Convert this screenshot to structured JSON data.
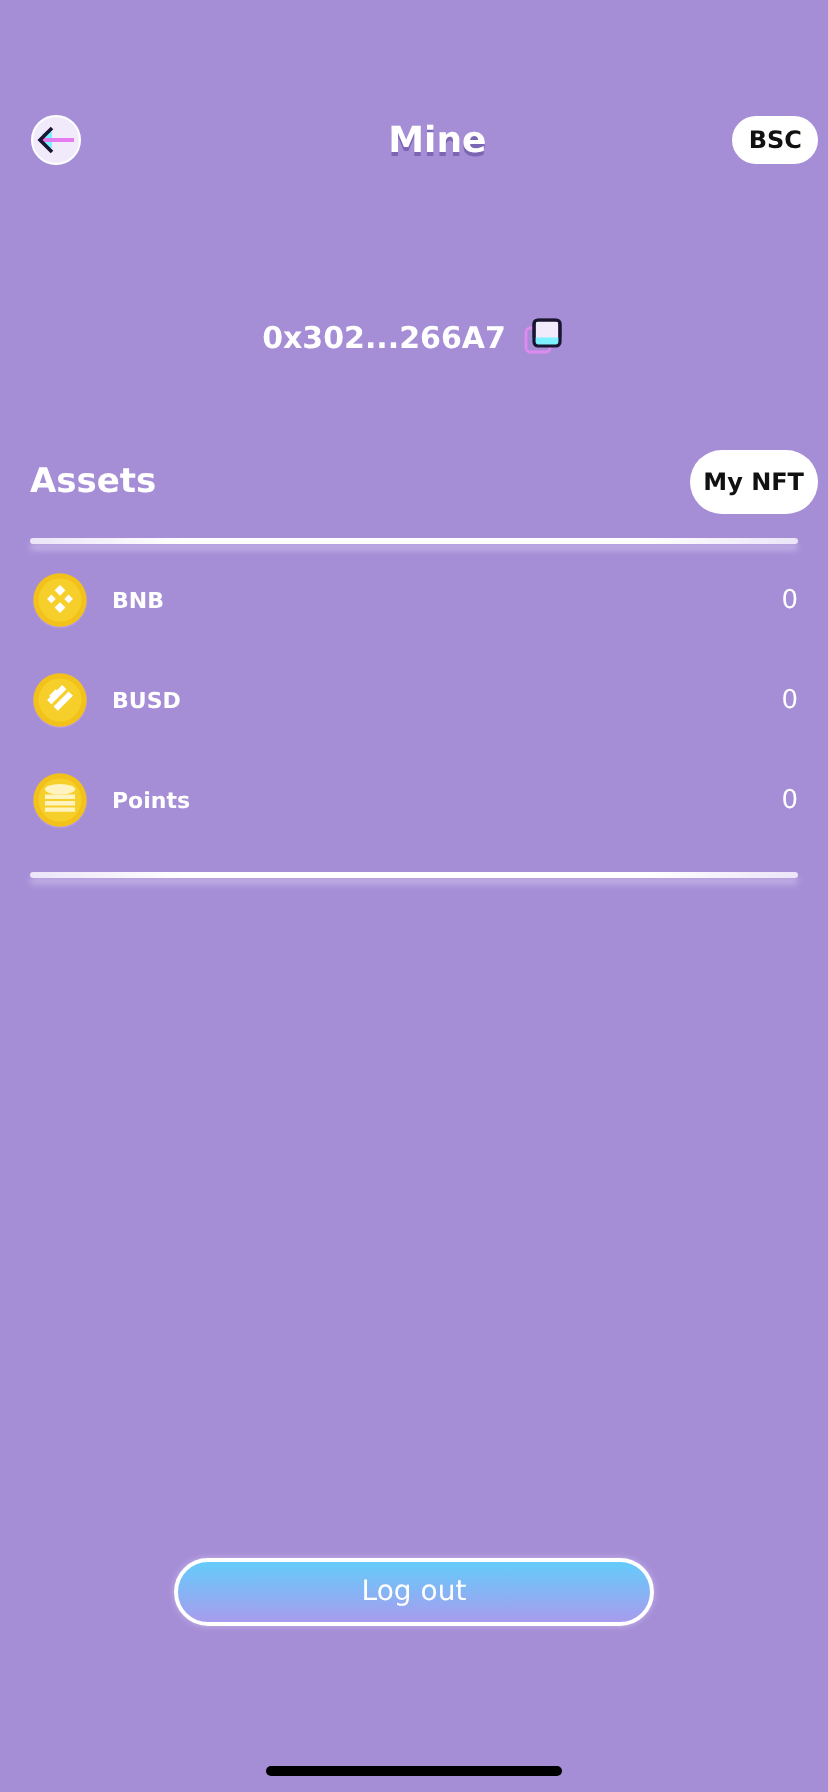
{
  "header": {
    "title": "Mine",
    "network": "BSC"
  },
  "address": "0x302...266A7",
  "assets": {
    "title": "Assets",
    "nft_button": "My NFT",
    "items": [
      {
        "kind": "diamond",
        "name": "BNB",
        "amount": "0"
      },
      {
        "kind": "stripes",
        "name": "BUSD",
        "amount": "0"
      },
      {
        "kind": "stack",
        "name": "Points",
        "amount": "0"
      }
    ]
  },
  "logout": "Log out"
}
